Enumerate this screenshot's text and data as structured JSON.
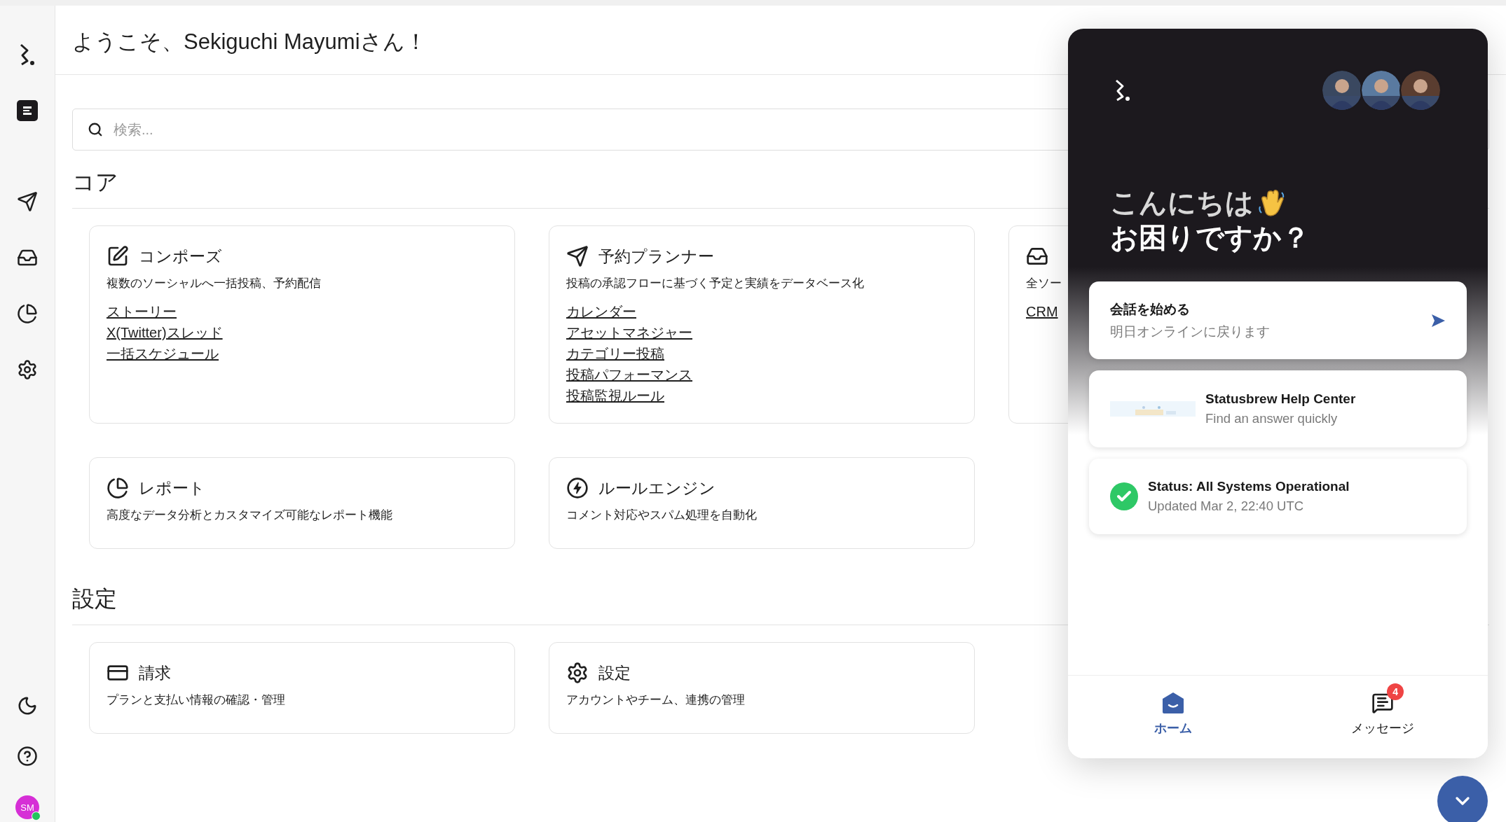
{
  "sidebar": {
    "top": [
      {
        "kind": "logo"
      },
      {
        "kind": "app"
      }
    ],
    "items": [
      {
        "kind": "send"
      },
      {
        "kind": "inbox"
      },
      {
        "kind": "report"
      },
      {
        "kind": "settings"
      }
    ],
    "bottom": [
      {
        "kind": "moon"
      },
      {
        "kind": "help"
      }
    ],
    "user": {
      "initials": "SM",
      "online": true
    }
  },
  "header": {
    "title": "ようこそ、Sekiguchi Mayumiさん！"
  },
  "search": {
    "placeholder": "検索..."
  },
  "sections": [
    {
      "title": "コア",
      "cards": [
        {
          "kind": "compose",
          "title": "コンポーズ",
          "description": "複数のソーシャルへ一括投稿、予約配信",
          "links": [
            "ストーリー",
            "X(Twitter)スレッド",
            "一括スケジュール"
          ]
        },
        {
          "kind": "send",
          "title": "予約プランナー",
          "description": "投稿の承認フローに基づく予定と実績をデータベース化",
          "links": [
            "カレンダー",
            "アセットマネジャー",
            "カテゴリー投稿",
            "投稿パフォーマンス",
            "投稿監視ルール"
          ]
        },
        {
          "kind": "inbox",
          "description": "全ソー",
          "links": [
            "CRM"
          ]
        },
        {
          "kind": "report",
          "title": "レポート",
          "description": "高度なデータ分析とカスタマイズ可能なレポート機能"
        },
        {
          "kind": "rules",
          "title": "ルールエンジン",
          "description": "コメント対応やスパム処理を自動化"
        }
      ]
    },
    {
      "title": "設定",
      "cards": [
        {
          "kind": "billing",
          "title": "請求",
          "description": "プランと支払い情報の確認・管理"
        },
        {
          "kind": "settings",
          "title": "設定",
          "description": "アカウントやチーム、連携の管理"
        }
      ]
    }
  ],
  "chat_widget": {
    "greeting": "こんにちは",
    "question": "お困りですか？",
    "start_conversation": {
      "title": "会話を始める",
      "subtitle": "明日オンラインに戻ります"
    },
    "help_center": {
      "title": "Statusbrew Help Center",
      "subtitle": "Find an answer quickly"
    },
    "status": {
      "title": "Status: All Systems Operational",
      "subtitle": "Updated Mar 2, 22:40 UTC",
      "operational": true
    },
    "tabs": [
      {
        "kind": "home",
        "label": "ホーム",
        "selected": true
      },
      {
        "kind": "messages",
        "label": "メッセージ",
        "selected": false,
        "badge": "4"
      }
    ]
  }
}
